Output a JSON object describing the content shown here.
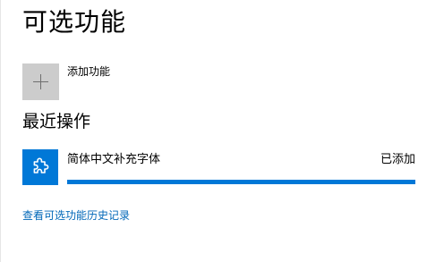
{
  "page": {
    "title": "可选功能"
  },
  "add_feature": {
    "label": "添加功能",
    "icon": "plus-icon"
  },
  "recent": {
    "heading": "最近操作",
    "items": [
      {
        "name": "简体中文补充字体",
        "status": "已添加",
        "icon": "puzzle-piece-icon",
        "progress_percent": 100
      }
    ]
  },
  "history_link": {
    "label": "查看可选功能历史记录"
  },
  "colors": {
    "accent": "#0078d7",
    "tile_gray": "#cccccc",
    "link": "#0067b8"
  }
}
